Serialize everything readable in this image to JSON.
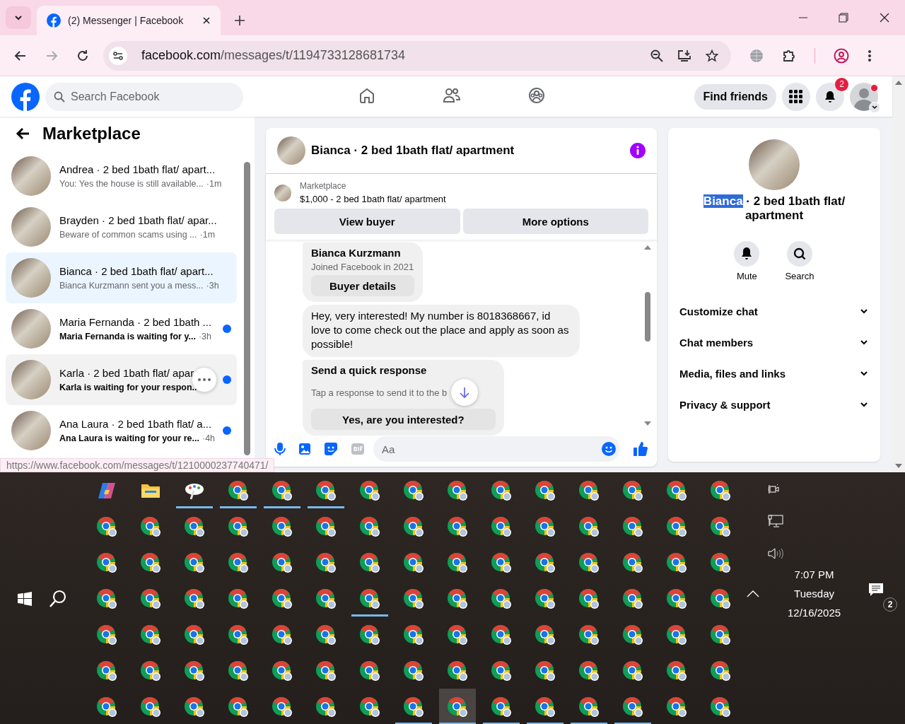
{
  "browser": {
    "tab": {
      "title": "(2) Messenger | Facebook",
      "selected": true
    },
    "url_domain": "facebook.com",
    "url_path": "/messages/t/1194733128681734",
    "forward_disabled": true
  },
  "facebook": {
    "search": {
      "placeholder": "Search Facebook"
    },
    "nav": [
      {
        "kind": "home",
        "selected": false
      },
      {
        "kind": "friends",
        "selected": false
      },
      {
        "kind": "groups",
        "selected": false
      }
    ],
    "find_friends": "Find friends",
    "notifications_badge": "2",
    "account_dot": true
  },
  "inbox": {
    "title": "Marketplace",
    "conversations": [
      {
        "title": "Andrea · 2 bed 1bath flat/ apart...",
        "preview": "You: Yes the house is still available...",
        "time": "·1m",
        "unread": false,
        "selected": false,
        "hovered": false
      },
      {
        "title": "Brayden · 2 bed 1bath flat/ apar...",
        "preview": "Beware of common scams using ...",
        "time": "·1m",
        "unread": false,
        "selected": false,
        "hovered": false
      },
      {
        "title": "Bianca · 2 bed 1bath flat/ apart...",
        "preview": "Bianca Kurzmann sent you a mess...",
        "time": "·3h",
        "unread": false,
        "selected": true,
        "hovered": false
      },
      {
        "title": "Maria Fernanda · 2 bed 1bath ...",
        "preview": "Maria Fernanda is waiting for y...",
        "time": "·3h",
        "unread": true,
        "selected": false,
        "hovered": false
      },
      {
        "title": "Karla · 2 bed 1bath flat/ apar",
        "preview": "Karla is waiting for your respon..",
        "unread": true,
        "selected": false,
        "hovered": true
      },
      {
        "title": "Ana Laura · 2 bed 1bath flat/ a...",
        "preview": "Ana Laura is waiting for your re...",
        "time": "·4h",
        "unread": true,
        "selected": false,
        "hovered": false
      }
    ]
  },
  "status_url": "https://www.facebook.com/messages/t/1210000237740471/",
  "chat": {
    "title": "Bianca · 2 bed 1bath flat/ apartment",
    "listing_label": "Marketplace",
    "listing_text": "$1,000 - 2 bed 1bath flat/ apartment",
    "buttons": [
      "View buyer",
      "More options"
    ],
    "buyer_card": {
      "name": "Bianca Kurzmann",
      "joined": "Joined Facebook in 2021",
      "button": "Buyer details"
    },
    "messages": [
      "Hey, very interested! My number is 8018368667, id love to come check out the place and apply as soon as possible!"
    ],
    "quick_response": {
      "title": "Send a quick response",
      "hint": "Tap a response to send it to the b",
      "options": [
        "Yes, are you interested?"
      ]
    },
    "composer": {
      "placeholder": "Aa"
    }
  },
  "details": {
    "name": "Bianca",
    "name_selected": true,
    "title_rest": "· 2 bed 1bath flat/ apartment",
    "actions": [
      {
        "kind": "mute",
        "label": "Mute"
      },
      {
        "kind": "search",
        "label": "Search"
      }
    ],
    "sections": [
      {
        "label": "Customize chat",
        "expanded": false
      },
      {
        "label": "Chat members",
        "expanded": false
      },
      {
        "label": "Media, files and links",
        "expanded": false
      },
      {
        "label": "Privacy & support",
        "expanded": false
      }
    ]
  },
  "taskbar": {
    "rows": [
      [
        {
          "kind": "copilot",
          "running": false,
          "selected": false
        },
        {
          "kind": "files",
          "running": false,
          "selected": false
        },
        {
          "kind": "paint",
          "running": true,
          "selected": false
        },
        {
          "kind": "chrome",
          "running": true,
          "selected": false
        },
        {
          "kind": "chrome",
          "running": true,
          "selected": false
        },
        {
          "kind": "chrome",
          "running": true,
          "selected": false
        },
        {
          "kind": "chrome",
          "running": false,
          "selected": false
        },
        {
          "kind": "chrome",
          "running": false,
          "selected": false
        },
        {
          "kind": "chrome",
          "running": false,
          "selected": false
        },
        {
          "kind": "chrome",
          "running": false,
          "selected": false
        },
        {
          "kind": "chrome",
          "running": false,
          "selected": false
        },
        {
          "kind": "chrome",
          "running": false,
          "selected": false
        },
        {
          "kind": "chrome",
          "running": false,
          "selected": false
        },
        {
          "kind": "chrome",
          "running": false,
          "selected": false
        },
        {
          "kind": "chrome",
          "running": false,
          "selected": false
        }
      ],
      [
        {
          "kind": "chrome",
          "running": false,
          "selected": false
        },
        {
          "kind": "chrome",
          "running": false,
          "selected": false
        },
        {
          "kind": "chrome",
          "running": false,
          "selected": false
        },
        {
          "kind": "chrome",
          "running": false,
          "selected": false
        },
        {
          "kind": "chrome",
          "running": false,
          "selected": false
        },
        {
          "kind": "chrome",
          "running": false,
          "selected": false
        },
        {
          "kind": "chrome",
          "running": false,
          "selected": false
        },
        {
          "kind": "chrome",
          "running": false,
          "selected": false
        },
        {
          "kind": "chrome",
          "running": false,
          "selected": false
        },
        {
          "kind": "chrome",
          "running": false,
          "selected": false
        },
        {
          "kind": "chrome",
          "running": false,
          "selected": false
        },
        {
          "kind": "chrome",
          "running": false,
          "selected": false
        },
        {
          "kind": "chrome",
          "running": false,
          "selected": false
        },
        {
          "kind": "chrome",
          "running": false,
          "selected": false
        },
        {
          "kind": "chrome",
          "running": false,
          "selected": false
        }
      ],
      [
        {
          "kind": "chrome",
          "running": false,
          "selected": false
        },
        {
          "kind": "chrome",
          "running": false,
          "selected": false
        },
        {
          "kind": "chrome",
          "running": false,
          "selected": false
        },
        {
          "kind": "chrome",
          "running": false,
          "selected": false
        },
        {
          "kind": "chrome",
          "running": false,
          "selected": false
        },
        {
          "kind": "chrome",
          "running": false,
          "selected": false
        },
        {
          "kind": "chrome",
          "running": false,
          "selected": false
        },
        {
          "kind": "chrome",
          "running": false,
          "selected": false
        },
        {
          "kind": "chrome",
          "running": false,
          "selected": false
        },
        {
          "kind": "chrome",
          "running": false,
          "selected": false
        },
        {
          "kind": "chrome",
          "running": false,
          "selected": false
        },
        {
          "kind": "chrome",
          "running": false,
          "selected": false
        },
        {
          "kind": "chrome",
          "running": false,
          "selected": false
        },
        {
          "kind": "chrome",
          "running": false,
          "selected": false
        },
        {
          "kind": "chrome",
          "running": false,
          "selected": false
        }
      ],
      [
        {
          "kind": "chrome",
          "running": false,
          "selected": false
        },
        {
          "kind": "chrome",
          "running": false,
          "selected": false
        },
        {
          "kind": "chrome",
          "running": false,
          "selected": false
        },
        {
          "kind": "chrome",
          "running": false,
          "selected": false
        },
        {
          "kind": "chrome",
          "running": false,
          "selected": false
        },
        {
          "kind": "chrome",
          "running": false,
          "selected": false
        },
        {
          "kind": "chrome",
          "running": true,
          "selected": false
        },
        {
          "kind": "chrome",
          "running": false,
          "selected": false
        },
        {
          "kind": "chrome",
          "running": false,
          "selected": false
        },
        {
          "kind": "chrome",
          "running": false,
          "selected": false
        },
        {
          "kind": "chrome",
          "running": false,
          "selected": false
        },
        {
          "kind": "chrome",
          "running": false,
          "selected": false
        },
        {
          "kind": "chrome",
          "running": false,
          "selected": false
        },
        {
          "kind": "chrome",
          "running": false,
          "selected": false
        },
        {
          "kind": "chrome",
          "running": false,
          "selected": false
        }
      ],
      [
        {
          "kind": "chrome",
          "running": false,
          "selected": false
        },
        {
          "kind": "chrome",
          "running": false,
          "selected": false
        },
        {
          "kind": "chrome",
          "running": false,
          "selected": false
        },
        {
          "kind": "chrome",
          "running": false,
          "selected": false
        },
        {
          "kind": "chrome",
          "running": false,
          "selected": false
        },
        {
          "kind": "chrome",
          "running": false,
          "selected": false
        },
        {
          "kind": "chrome",
          "running": false,
          "selected": false
        },
        {
          "kind": "chrome",
          "running": false,
          "selected": false
        },
        {
          "kind": "chrome",
          "running": false,
          "selected": false
        },
        {
          "kind": "chrome",
          "running": false,
          "selected": false
        },
        {
          "kind": "chrome",
          "running": false,
          "selected": false
        },
        {
          "kind": "chrome",
          "running": false,
          "selected": false
        },
        {
          "kind": "chrome",
          "running": false,
          "selected": false
        },
        {
          "kind": "chrome",
          "running": false,
          "selected": false
        },
        {
          "kind": "chrome",
          "running": false,
          "selected": false
        }
      ],
      [
        {
          "kind": "chrome",
          "running": false,
          "selected": false
        },
        {
          "kind": "chrome",
          "running": false,
          "selected": false
        },
        {
          "kind": "chrome",
          "running": false,
          "selected": false
        },
        {
          "kind": "chrome",
          "running": false,
          "selected": false
        },
        {
          "kind": "chrome",
          "running": false,
          "selected": false
        },
        {
          "kind": "chrome",
          "running": false,
          "selected": false
        },
        {
          "kind": "chrome",
          "running": false,
          "selected": false
        },
        {
          "kind": "chrome",
          "running": false,
          "selected": false
        },
        {
          "kind": "chrome",
          "running": false,
          "selected": false
        },
        {
          "kind": "chrome",
          "running": false,
          "selected": false
        },
        {
          "kind": "chrome",
          "running": false,
          "selected": false
        },
        {
          "kind": "chrome",
          "running": false,
          "selected": false
        },
        {
          "kind": "chrome",
          "running": false,
          "selected": false
        },
        {
          "kind": "chrome",
          "running": false,
          "selected": false
        },
        {
          "kind": "chrome",
          "running": false,
          "selected": false
        }
      ],
      [
        {
          "kind": "chrome",
          "running": false,
          "selected": false
        },
        {
          "kind": "chrome",
          "running": false,
          "selected": false
        },
        {
          "kind": "chrome",
          "running": false,
          "selected": false
        },
        {
          "kind": "chrome",
          "running": false,
          "selected": false
        },
        {
          "kind": "chrome",
          "running": false,
          "selected": false
        },
        {
          "kind": "chrome",
          "running": false,
          "selected": false
        },
        {
          "kind": "chrome",
          "running": false,
          "selected": false
        },
        {
          "kind": "chrome",
          "running": true,
          "selected": false
        },
        {
          "kind": "chrome",
          "running": true,
          "selected": true
        },
        {
          "kind": "chrome",
          "running": true,
          "selected": false
        },
        {
          "kind": "chrome",
          "running": true,
          "selected": false
        },
        {
          "kind": "chrome",
          "running": true,
          "selected": false
        },
        {
          "kind": "chrome",
          "running": true,
          "selected": false
        },
        {
          "kind": "chrome",
          "running": false,
          "selected": false
        },
        {
          "kind": "chrome",
          "running": false,
          "selected": false
        }
      ]
    ],
    "tray": {
      "time": "7:07 PM",
      "day": "Tuesday",
      "date": "12/16/2025",
      "notifications": "2"
    }
  }
}
